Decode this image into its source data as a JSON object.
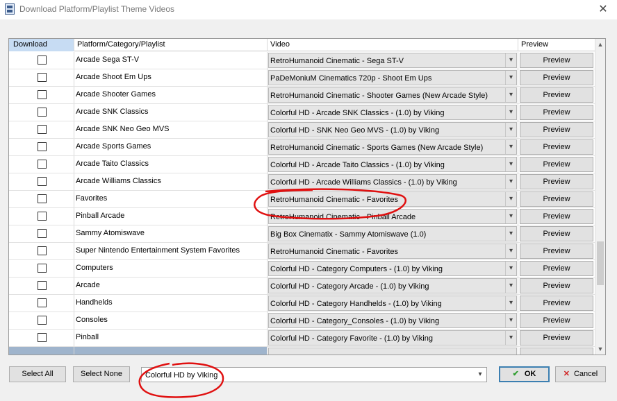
{
  "window": {
    "title": "Download Platform/Playlist Theme Videos",
    "close_glyph": "✕"
  },
  "grid": {
    "columns": [
      "Download",
      "Platform/Category/Playlist",
      "Video",
      "Preview"
    ],
    "preview_label": "Preview",
    "rows": [
      {
        "platform": "Arcade Sega ST-V",
        "video": "RetroHumanoid Cinematic - Sega ST-V"
      },
      {
        "platform": "Arcade Shoot Em Ups",
        "video": "PaDeMoniuM Cinematics 720p - Shoot Em Ups"
      },
      {
        "platform": "Arcade Shooter Games",
        "video": "RetroHumanoid Cinematic - Shooter Games (New Arcade Style)"
      },
      {
        "platform": "Arcade SNK Classics",
        "video": "Colorful HD - Arcade SNK Classics - (1.0) by Viking"
      },
      {
        "platform": "Arcade SNK Neo Geo MVS",
        "video": "Colorful HD - SNK Neo Geo MVS - (1.0) by Viking"
      },
      {
        "platform": "Arcade Sports Games",
        "video": "RetroHumanoid Cinematic - Sports Games (New Arcade Style)"
      },
      {
        "platform": "Arcade Taito Classics",
        "video": "Colorful HD - Arcade Taito Classics - (1.0) by Viking"
      },
      {
        "platform": "Arcade Williams Classics",
        "video": "Colorful HD - Arcade Williams Classics - (1.0) by Viking"
      },
      {
        "platform": "Favorites",
        "video": "RetroHumanoid Cinematic - Favorites"
      },
      {
        "platform": "Pinball Arcade",
        "video": "RetroHumanoid Cinematic - Pinball Arcade"
      },
      {
        "platform": "Sammy Atomiswave",
        "video": "Big Box Cinematix - Sammy Atomiswave (1.0)"
      },
      {
        "platform": "Super Nintendo Entertainment System Favorites",
        "video": "RetroHumanoid Cinematic - Favorites"
      },
      {
        "platform": "Computers",
        "video": "Colorful HD - Category Computers - (1.0) by Viking"
      },
      {
        "platform": "Arcade",
        "video": "Colorful HD - Category Arcade - (1.0) by Viking"
      },
      {
        "platform": "Handhelds",
        "video": "Colorful HD - Category Handhelds - (1.0) by Viking"
      },
      {
        "platform": "Consoles",
        "video": "Colorful HD - Category_Consoles - (1.0) by Viking"
      },
      {
        "platform": "Pinball",
        "video": "Colorful HD - Category Favorite - (1.0) by Viking"
      }
    ]
  },
  "buttons": {
    "select_all": "Select All",
    "select_none": "Select None",
    "ok": "OK",
    "cancel": "Cancel"
  },
  "theme_selector": {
    "value": "Colorful HD by Viking"
  },
  "colors": {
    "header_selected": "#c7dcf3",
    "annotation": "#e01010",
    "ok_border": "#3c7fb1"
  },
  "icons": {
    "ok": "checkmark-icon",
    "cancel": "cross-icon",
    "dropdown": "chevron-down-icon"
  }
}
